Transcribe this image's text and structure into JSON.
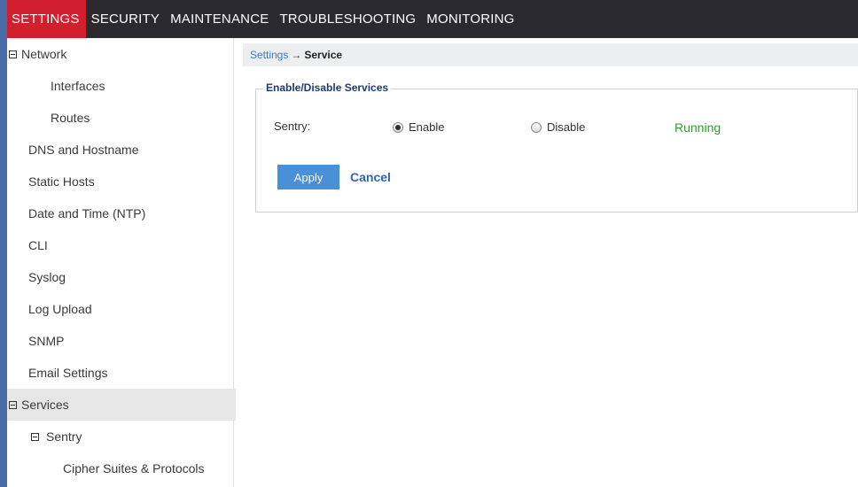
{
  "topnav": {
    "tabs": [
      "SETTINGS",
      "SECURITY",
      "MAINTENANCE",
      "TROUBLESHOOTING",
      "MONITORING"
    ],
    "active": "SETTINGS"
  },
  "sidebar": {
    "items": [
      {
        "label": "Network"
      },
      {
        "label": "Interfaces"
      },
      {
        "label": "Routes"
      },
      {
        "label": "DNS and Hostname"
      },
      {
        "label": "Static Hosts"
      },
      {
        "label": "Date and Time (NTP)"
      },
      {
        "label": "CLI"
      },
      {
        "label": "Syslog"
      },
      {
        "label": "Log Upload"
      },
      {
        "label": "SNMP"
      },
      {
        "label": "Email Settings"
      },
      {
        "label": "Services"
      },
      {
        "label": "Sentry"
      },
      {
        "label": "Cipher Suites & Protocols"
      }
    ]
  },
  "breadcrumb": {
    "parent": "Settings",
    "arrow": "→",
    "current": "Service"
  },
  "services_panel": {
    "legend": "Enable/Disable Services",
    "sentry_label": "Sentry:",
    "enable_label": "Enable",
    "disable_label": "Disable",
    "selected": "Enable",
    "status": "Running",
    "apply_label": "Apply",
    "cancel_label": "Cancel"
  },
  "colors": {
    "active_tab": "#d0202e",
    "topnav_bg": "#2b2b2f",
    "status_green": "#2aa12a",
    "apply_blue": "#4a90d9",
    "link_blue": "#2f63b5"
  }
}
